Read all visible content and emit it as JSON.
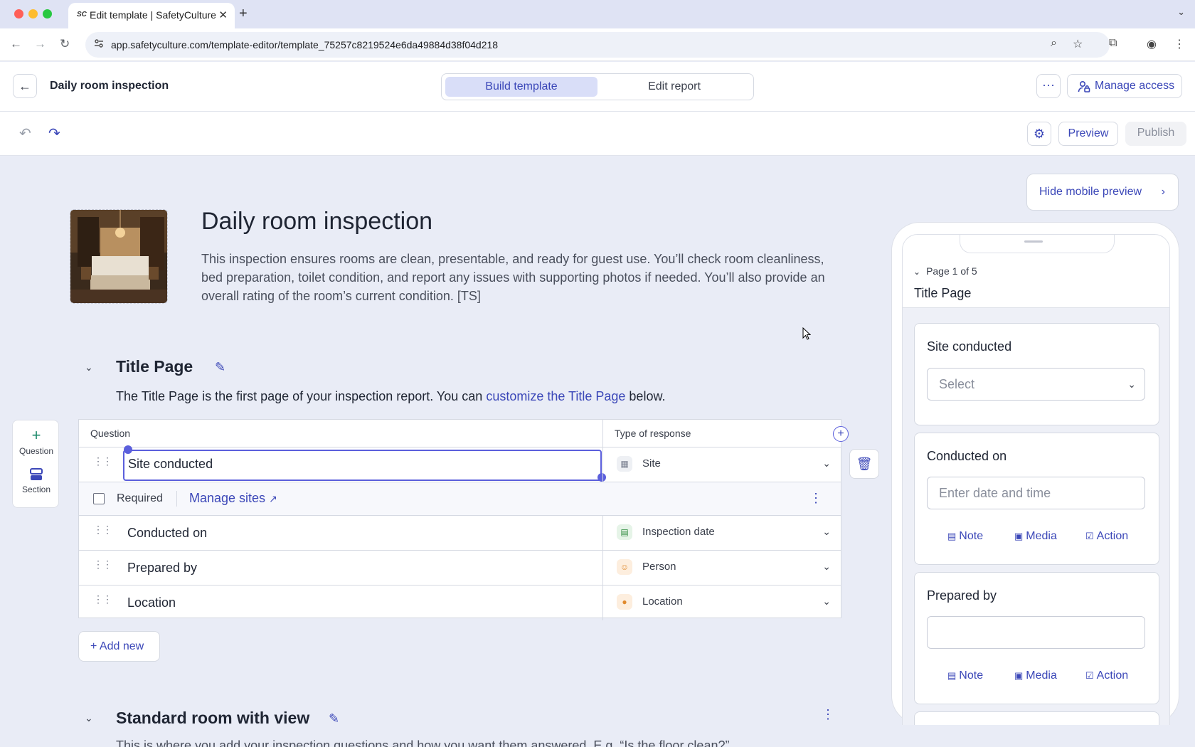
{
  "browser": {
    "tab_title": "Edit template | SafetyCulture",
    "tab_favicon": "SC",
    "url": "app.safetyculture.com/template-editor/template_75257c8219524e6da49884d38f04d218"
  },
  "header": {
    "title": "Daily room inspection",
    "tabs": [
      "Build template",
      "Edit report"
    ],
    "manage_access": "Manage access"
  },
  "toolbar": {
    "preview": "Preview",
    "publish": "Publish"
  },
  "template": {
    "title": "Daily room inspection",
    "description": "This inspection ensures rooms are clean, presentable, and ready for guest use. You’ll check room cleanliness, bed preparation, toilet condition, and report any issues with supporting photos if needed. You’ll also provide an overall rating of the room’s current condition. [TS]",
    "hide_preview": "Hide mobile preview"
  },
  "section1": {
    "title": "Title Page",
    "desc_before": "The Title Page is the first page of your inspection report. You can ",
    "desc_link": "customize the Title Page",
    "desc_after": " below."
  },
  "leftbar": {
    "question": "Question",
    "section": "Section"
  },
  "table": {
    "col_question": "Question",
    "col_response": "Type of response",
    "required_label": "Required",
    "manage_sites": "Manage sites",
    "rows": [
      {
        "question": "Site conducted",
        "response": "Site"
      },
      {
        "question": "Conducted on",
        "response": "Inspection date"
      },
      {
        "question": "Prepared by",
        "response": "Person"
      },
      {
        "question": "Location",
        "response": "Location"
      }
    ]
  },
  "add_new": "Add new",
  "section2": {
    "title": "Standard room with view",
    "desc": "This is where you add your inspection questions and how you want them answered. E.g. “Is the floor clean?”"
  },
  "mobile": {
    "page_of": "Page 1 of 5",
    "page_title": "Title Page",
    "cards": [
      {
        "label": "Site conducted",
        "placeholder": "Select"
      },
      {
        "label": "Conducted on",
        "placeholder": "Enter date and time"
      },
      {
        "label": "Prepared by",
        "placeholder": ""
      }
    ],
    "actions": [
      "Note",
      "Media",
      "Action"
    ]
  },
  "colors": {
    "accent": "#3b47b8",
    "selection": "#5b5fdc",
    "canvas": "#e9ecf6"
  }
}
